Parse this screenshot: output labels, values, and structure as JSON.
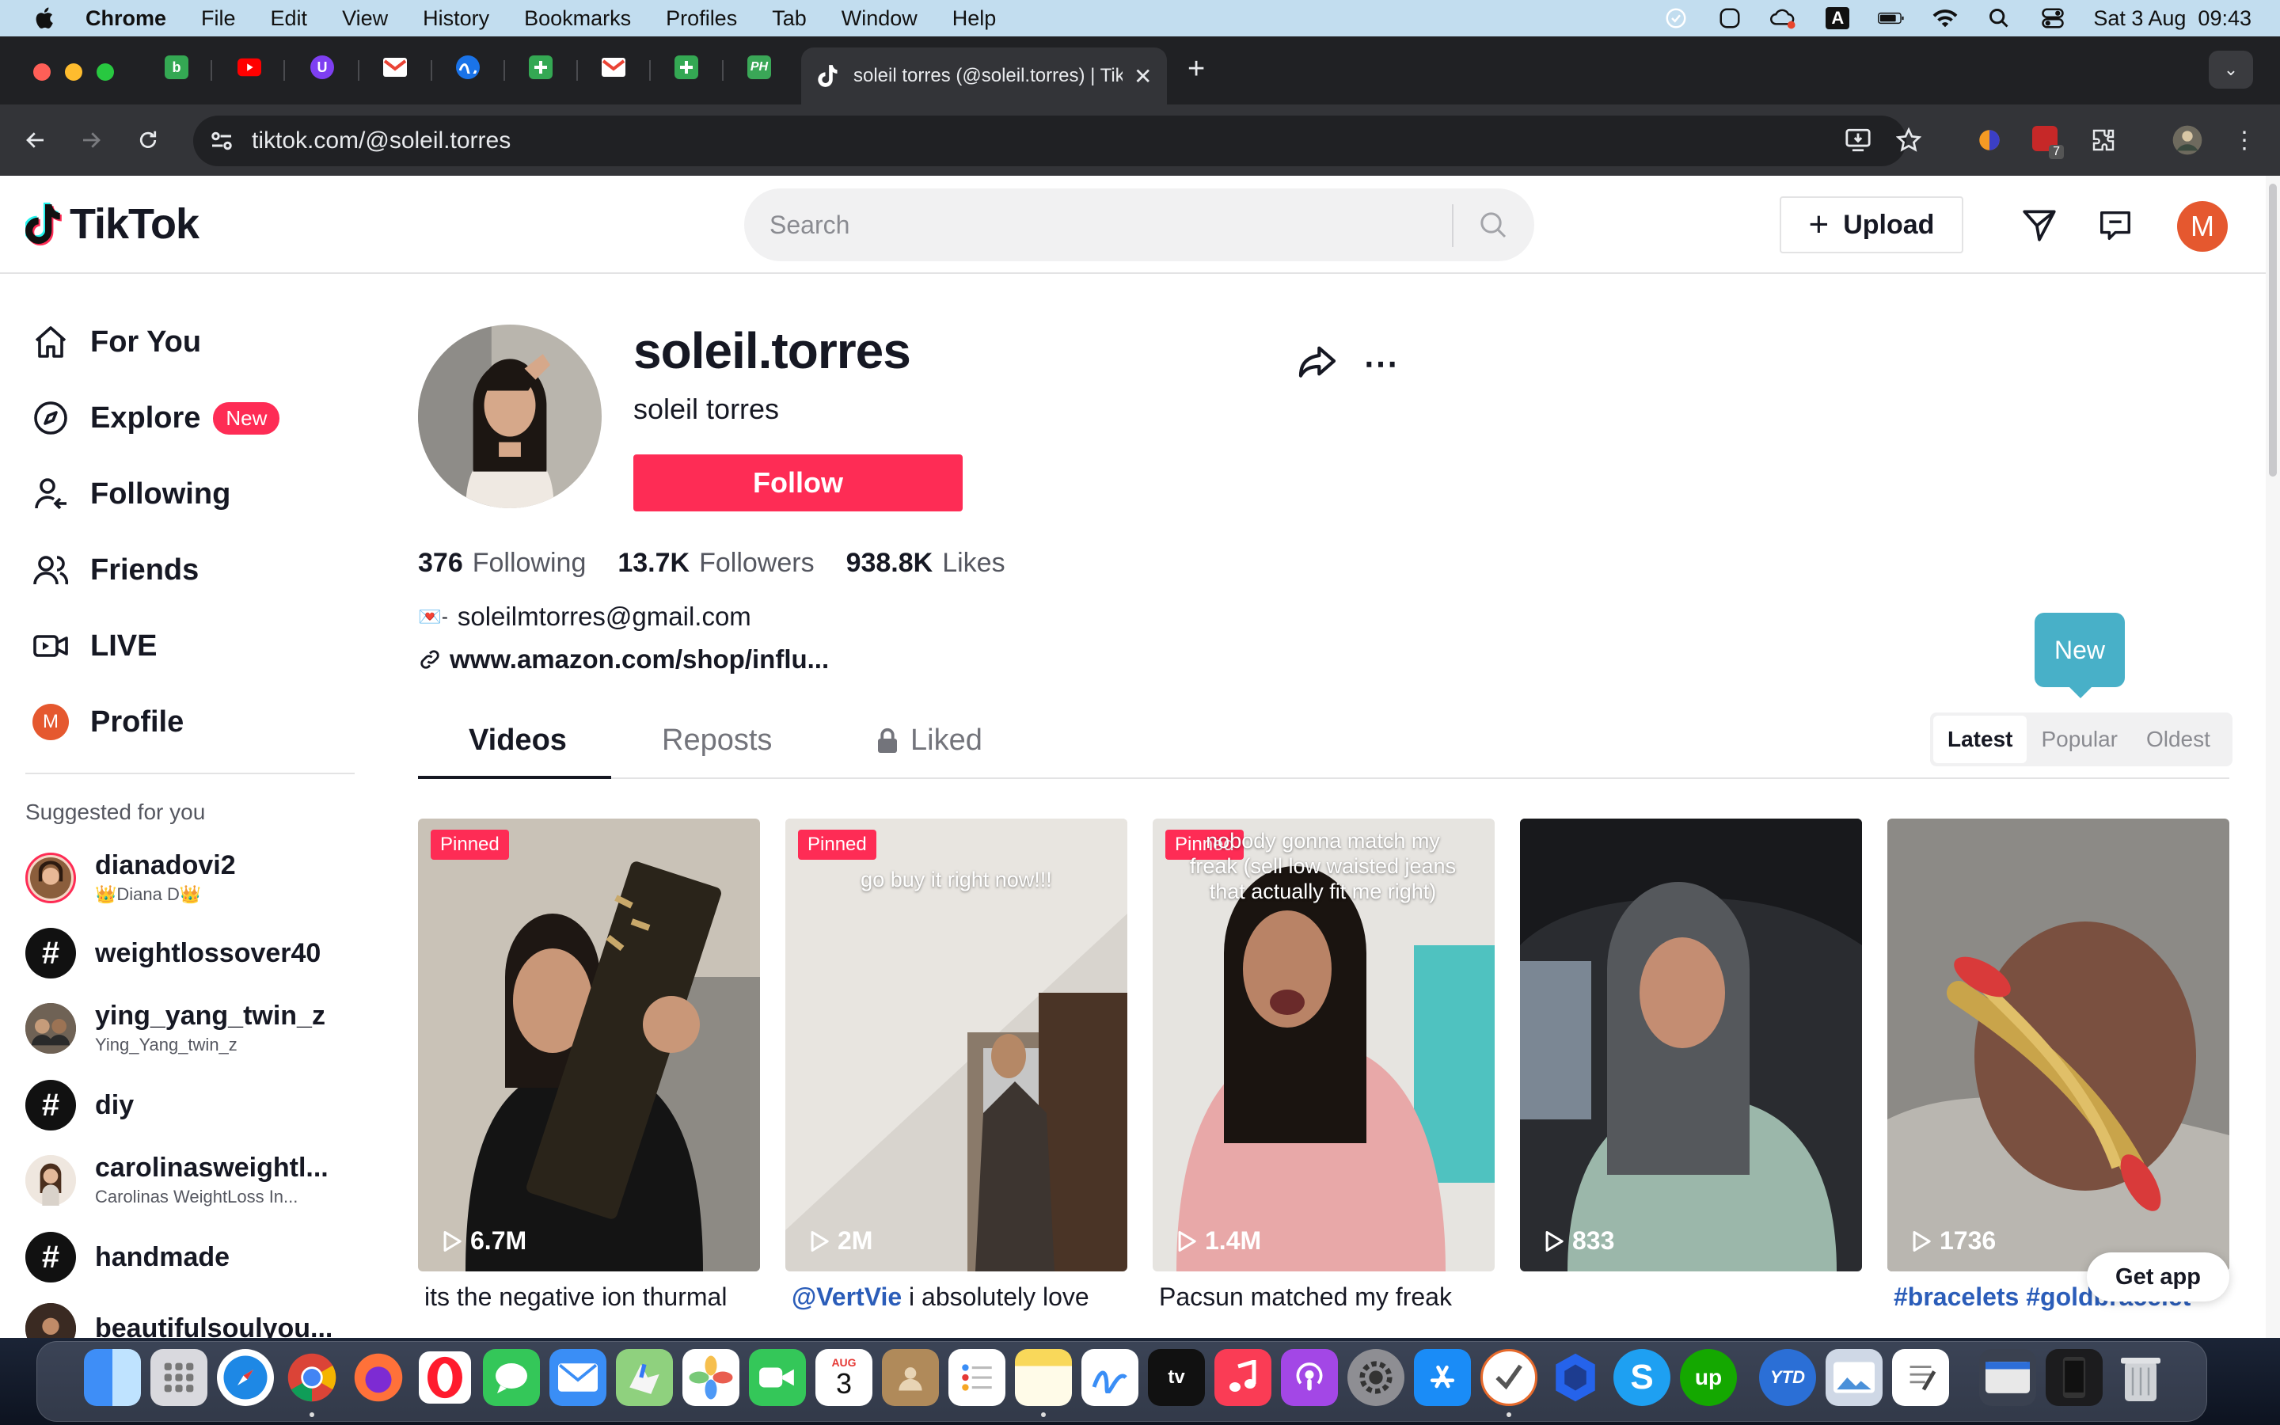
{
  "menubar": {
    "app": "Chrome",
    "items": [
      "File",
      "Edit",
      "View",
      "History",
      "Bookmarks",
      "Profiles",
      "Tab",
      "Window",
      "Help"
    ],
    "datetime": "Sat 3 Aug  09:43",
    "input_source": "A"
  },
  "browser": {
    "active_tab_title": "soleil torres (@soleil.torres) | TikTok",
    "url": "tiktok.com/@soleil.torres",
    "extension_badge": "7",
    "tab_favicons": [
      "b",
      "yt",
      "U",
      "M",
      "wave",
      "+",
      "M",
      "+",
      "PH"
    ]
  },
  "header": {
    "logo": "TikTok",
    "search_placeholder": "Search",
    "upload_label": "Upload",
    "avatar_initial": "M"
  },
  "sidebar": {
    "nav": [
      {
        "label": "For You",
        "icon": "home-icon"
      },
      {
        "label": "Explore",
        "icon": "compass-icon",
        "badge": "New"
      },
      {
        "label": "Following",
        "icon": "user-follow-icon"
      },
      {
        "label": "Friends",
        "icon": "friends-icon"
      },
      {
        "label": "LIVE",
        "icon": "live-icon"
      },
      {
        "label": "Profile",
        "icon": "profile-icon",
        "initial": "M"
      }
    ],
    "suggested_title": "Suggested for you",
    "suggested": [
      {
        "name": "dianadovi2",
        "sub": "👑Diana D👑",
        "type": "user"
      },
      {
        "name": "weightlossover40",
        "sub": "",
        "type": "hashtag"
      },
      {
        "name": "ying_yang_twin_z",
        "sub": "Ying_Yang_twin_z",
        "type": "user"
      },
      {
        "name": "diy",
        "sub": "",
        "type": "hashtag"
      },
      {
        "name": "carolinasweightl...",
        "sub": "Carolinas WeightLoss In...",
        "type": "user"
      },
      {
        "name": "handmade",
        "sub": "",
        "type": "hashtag"
      },
      {
        "name": "beautifulsoulyou...",
        "sub": "",
        "type": "user"
      }
    ]
  },
  "profile": {
    "username": "soleil.torres",
    "display_name": "soleil torres",
    "follow_label": "Follow",
    "stats": [
      {
        "value": "376",
        "label": "Following"
      },
      {
        "value": "13.7K",
        "label": "Followers"
      },
      {
        "value": "938.8K",
        "label": "Likes"
      }
    ],
    "bio_prefix": "💌-",
    "bio_email": "soleilmtorres@gmail.com",
    "bio_link": "www.amazon.com/shop/influ..."
  },
  "tooltip": "New",
  "tabs": [
    "Videos",
    "Reposts",
    "Liked"
  ],
  "sort_options": [
    "Latest",
    "Popular",
    "Oldest"
  ],
  "videos": [
    {
      "pinned": "Pinned",
      "views": "6.7M",
      "overlay": "",
      "caption_tag": "",
      "caption": "its the negative ion thurmal"
    },
    {
      "pinned": "Pinned",
      "views": "2M",
      "overlay": "go buy it right now!!!",
      "caption_tag": "@VertVie",
      "caption": " i absolutely love"
    },
    {
      "pinned": "Pinned",
      "views": "1.4M",
      "overlay": "nobody gonna match my freak (sell low waisted jeans that actually fit me right)",
      "caption_tag": "",
      "caption": "Pacsun matched my freak"
    },
    {
      "pinned": "",
      "views": "833",
      "overlay": "",
      "caption_tag": "",
      "caption": ""
    },
    {
      "pinned": "",
      "views": "1736",
      "overlay": "",
      "caption_tag": "#bracelets #goldbracelet",
      "caption": ""
    }
  ],
  "get_app_label": "Get app",
  "dock": {
    "calendar_month": "AUG",
    "calendar_day": "3",
    "apps": [
      "Finder",
      "Launchpad",
      "Safari",
      "Chrome",
      "Firefox",
      "Opera",
      "Messages",
      "Mail",
      "Maps",
      "Photos",
      "FaceTime",
      "Calendar",
      "Contacts",
      "Reminders",
      "Notes",
      "Freeform",
      "TV",
      "Music",
      "Podcasts",
      "System Settings",
      "App Store",
      "OmniFocus",
      "Proton VPN",
      "Skype",
      "Upwork",
      "YTD",
      "Preview",
      "TextEdit",
      "Screenshot",
      "Trash"
    ]
  }
}
